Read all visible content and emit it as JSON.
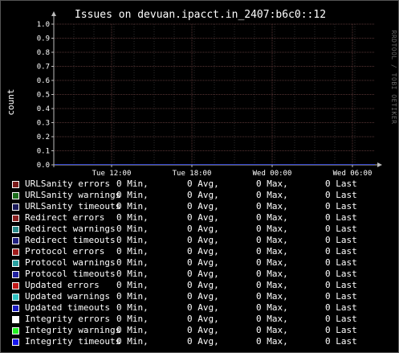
{
  "chart_data": {
    "type": "line",
    "title": "Issues on devuan.ipacct.in_2407:b6c0::12",
    "ylabel": "count",
    "xlabel": "",
    "ylim": [
      0,
      1
    ],
    "yticks": [
      "0.0",
      "0.1",
      "0.2",
      "0.3",
      "0.4",
      "0.5",
      "0.6",
      "0.7",
      "0.8",
      "0.9",
      "1.0"
    ],
    "xticks": [
      "Tue 12:00",
      "Tue 18:00",
      "Wed 00:00",
      "Wed 06:00"
    ],
    "grid": true,
    "legend_position": "bottom",
    "watermark": "RRDTOOL / TOBI OETIKER",
    "series": [
      {
        "name": "URLSanity errors",
        "color": "#7a1a1a",
        "min": "0 Min,",
        "avg": "0 Avg,",
        "max": "0 Max,",
        "last": "0 Last"
      },
      {
        "name": "URLSanity warnings",
        "color": "#1a6a1a",
        "min": "0 Min,",
        "avg": "0 Avg,",
        "max": "0 Max,",
        "last": "0 Last"
      },
      {
        "name": "URLSanity timeouts",
        "color": "#1a1a5a",
        "min": "0 Min,",
        "avg": "0 Avg,",
        "max": "0 Max,",
        "last": "0 Last"
      },
      {
        "name": "Redirect errors",
        "color": "#8a2020",
        "min": "0 Min,",
        "avg": "0 Avg,",
        "max": "0 Max,",
        "last": "0 Last"
      },
      {
        "name": "Redirect warnings",
        "color": "#2a8a8a",
        "min": "0 Min,",
        "avg": "0 Avg,",
        "max": "0 Max,",
        "last": "0 Last"
      },
      {
        "name": "Redirect timeouts",
        "color": "#202080",
        "min": "0 Min,",
        "avg": "0 Avg,",
        "max": "0 Max,",
        "last": "0 Last"
      },
      {
        "name": "Protocol errors",
        "color": "#a01c1c",
        "min": "0 Min,",
        "avg": "0 Avg,",
        "max": "0 Max,",
        "last": "0 Last"
      },
      {
        "name": "Protocol warnings",
        "color": "#2aa0a0",
        "min": "0 Min,",
        "avg": "0 Avg,",
        "max": "0 Max,",
        "last": "0 Last"
      },
      {
        "name": "Protocol timeouts",
        "color": "#2020a0",
        "min": "0 Min,",
        "avg": "0 Avg,",
        "max": "0 Max,",
        "last": "0 Last"
      },
      {
        "name": "Updated errors",
        "color": "#c01818",
        "min": "0 Min,",
        "avg": "0 Avg,",
        "max": "0 Max,",
        "last": "0 Last"
      },
      {
        "name": "Updated warnings",
        "color": "#30c0c0",
        "min": "0 Min,",
        "avg": "0 Avg,",
        "max": "0 Max,",
        "last": "0 Last"
      },
      {
        "name": "Updated timeouts",
        "color": "#1c1cc0",
        "min": "0 Min,",
        "avg": "0 Avg,",
        "max": "0 Max,",
        "last": "0 Last"
      },
      {
        "name": "Integrity errors",
        "color": "#ffffff",
        "min": "0 Min,",
        "avg": "0 Avg,",
        "max": "0 Max,",
        "last": "0 Last"
      },
      {
        "name": "Integrity warnings",
        "color": "#22ee22",
        "min": "0 Min,",
        "avg": "0 Avg,",
        "max": "0 Max,",
        "last": "0 Last"
      },
      {
        "name": "Integrity timeouts",
        "color": "#1818ee",
        "min": "0 Min,",
        "avg": "0 Avg,",
        "max": "0 Max,",
        "last": "0 Last"
      }
    ],
    "colors": {
      "background": "#000000",
      "grid_major": "#553333",
      "grid_minor": "#2a2a2a",
      "axis": "#bbbbbb",
      "baseline": "#3344cc"
    }
  }
}
